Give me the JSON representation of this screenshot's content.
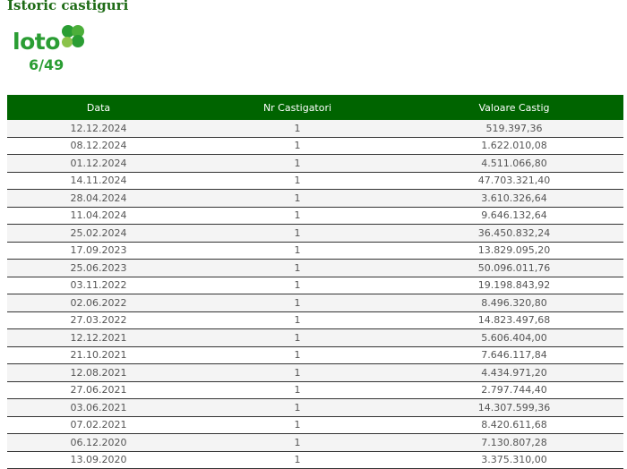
{
  "page": {
    "title": "Istoric castiguri"
  },
  "logo": {
    "word": "loto",
    "sub": "6/49",
    "color": "#2a9d33"
  },
  "table": {
    "headers": [
      "Data",
      "Nr Castigatori",
      "Valoare Castig"
    ],
    "rows": [
      [
        "12.12.2024",
        "1",
        "519.397,36"
      ],
      [
        "08.12.2024",
        "1",
        "1.622.010,08"
      ],
      [
        "01.12.2024",
        "1",
        "4.511.066,80"
      ],
      [
        "14.11.2024",
        "1",
        "47.703.321,40"
      ],
      [
        "28.04.2024",
        "1",
        "3.610.326,64"
      ],
      [
        "11.04.2024",
        "1",
        "9.646.132,64"
      ],
      [
        "25.02.2024",
        "1",
        "36.450.832,24"
      ],
      [
        "17.09.2023",
        "1",
        "13.829.095,20"
      ],
      [
        "25.06.2023",
        "1",
        "50.096.011,76"
      ],
      [
        "03.11.2022",
        "1",
        "19.198.843,92"
      ],
      [
        "02.06.2022",
        "1",
        "8.496.320,80"
      ],
      [
        "27.03.2022",
        "1",
        "14.823.497,68"
      ],
      [
        "12.12.2021",
        "1",
        "5.606.404,00"
      ],
      [
        "21.10.2021",
        "1",
        "7.646.117,84"
      ],
      [
        "12.08.2021",
        "1",
        "4.434.971,20"
      ],
      [
        "27.06.2021",
        "1",
        "2.797.744,40"
      ],
      [
        "03.06.2021",
        "1",
        "14.307.599,36"
      ],
      [
        "07.02.2021",
        "1",
        "8.420.611,68"
      ],
      [
        "06.12.2020",
        "1",
        "7.130.807,28"
      ],
      [
        "13.09.2020",
        "1",
        "3.375.310,00"
      ]
    ]
  }
}
